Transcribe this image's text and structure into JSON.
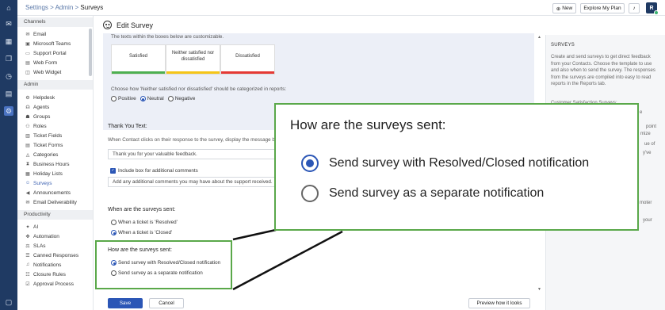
{
  "breadcrumb": {
    "part1": "Settings",
    "sep1": " > ",
    "part2": "Admin",
    "sep2": " > ",
    "current": "Surveys"
  },
  "topbar": {
    "new_label": "New",
    "explore_label": "Explore My Plan",
    "avatar_initial": "R"
  },
  "sidebar": {
    "channels_header": "Channels",
    "channels": [
      "Email",
      "Microsoft Teams",
      "Support Portal",
      "Web Form",
      "Web Widget"
    ],
    "admin_header": "Admin",
    "admin": [
      "Helpdesk",
      "Agents",
      "Groups",
      "Roles",
      "Ticket Fields",
      "Ticket Forms",
      "Categories",
      "Business Hours",
      "Holiday Lists",
      "Surveys",
      "Announcements",
      "Email Deliverability"
    ],
    "productivity_header": "Productivity",
    "productivity": [
      "AI",
      "Automation",
      "SLAs",
      "Canned Responses",
      "Notifications",
      "Closure Rules",
      "Approval Process"
    ]
  },
  "page": {
    "title": "Edit Survey"
  },
  "editor": {
    "customizable_note": "The texts within the boxes below are customizable.",
    "boxes": [
      "Satisfied",
      "Neither satisfied nor dissatisfied",
      "Dissatisfied"
    ],
    "box_colors": [
      "#4caf50",
      "#f5c518",
      "#e53935"
    ],
    "neutral_question": "Choose how 'Neither satisfied nor dissatisfied' should be categorized in reports:",
    "neutral_options": [
      "Positive",
      "Neutral",
      "Negative"
    ],
    "neutral_selected": "Neutral"
  },
  "thank_you": {
    "header": "Thank You Text:",
    "description": "When Contact clicks on their response to the survey, display the message below",
    "value": "Thank you for your valuable feedback.",
    "include_comments_label": "Include box for additional comments",
    "comments_placeholder": "Add any additional comments you may have about the support received."
  },
  "when_sent": {
    "header": "When are the surveys sent:",
    "options": [
      "When a ticket is 'Resolved'",
      "When a ticket is 'Closed'"
    ],
    "selected": "When a ticket is 'Closed'"
  },
  "how_sent": {
    "header": "How are the surveys sent:",
    "options": [
      "Send survey with Resolved/Closed notification",
      "Send survey as a separate notification"
    ],
    "selected": "Send survey with Resolved/Closed notification"
  },
  "footer": {
    "save": "Save",
    "cancel": "Cancel",
    "preview": "Preview how it looks"
  },
  "right_panel": {
    "heading": "SURVEYS",
    "body": "Create and send surveys to get direct feedback from your Contacts. Choose the template to use and also when to send the survey. The responses from the surveys are compiled into easy to read reports in the Reports tab.",
    "fragments": [
      "Customer Satisfaction Surveys:",
      "e",
      "point",
      "mize",
      "ue of",
      "y've",
      "moter",
      "your"
    ]
  },
  "zoom": {
    "header": "How are the surveys sent:",
    "options": [
      "Send survey with Resolved/Closed notification",
      "Send survey as a separate notification"
    ],
    "selected": "Send survey with Resolved/Closed notification"
  },
  "colors": {
    "rail": "#1f3a63",
    "accent": "#2b56b6",
    "highlight": "#5aa84a"
  }
}
